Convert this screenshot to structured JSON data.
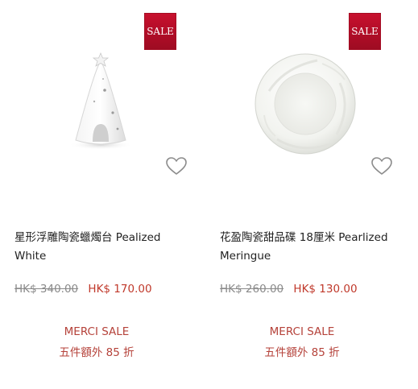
{
  "colors": {
    "sale_badge": "#b3111f",
    "new_price": "#c0392b",
    "promo_text": "#b5423a",
    "old_price": "#8a8a8a"
  },
  "products": [
    {
      "image_icon": "pearlized-white-cone-candle-holder",
      "badge": "SALE",
      "title_line1": "星形浮雕陶瓷蠟燭台 Pealized",
      "title_line2": "White",
      "old_price": "HK$ 340.00",
      "new_price": "HK$ 170.00",
      "promo_line1": "MERCI SALE",
      "promo_line2": "五件額外 85 折",
      "wishlist_icon": "heart-outline-icon"
    },
    {
      "image_icon": "pearlized-meringue-dessert-plate",
      "badge": "SALE",
      "title_line1": "花盈陶瓷甜品碟 18厘米 Pearlized",
      "title_line2": "Meringue",
      "old_price": "HK$ 260.00",
      "new_price": "HK$ 130.00",
      "promo_line1": "MERCI SALE",
      "promo_line2": "五件額外 85 折",
      "wishlist_icon": "heart-outline-icon"
    }
  ]
}
